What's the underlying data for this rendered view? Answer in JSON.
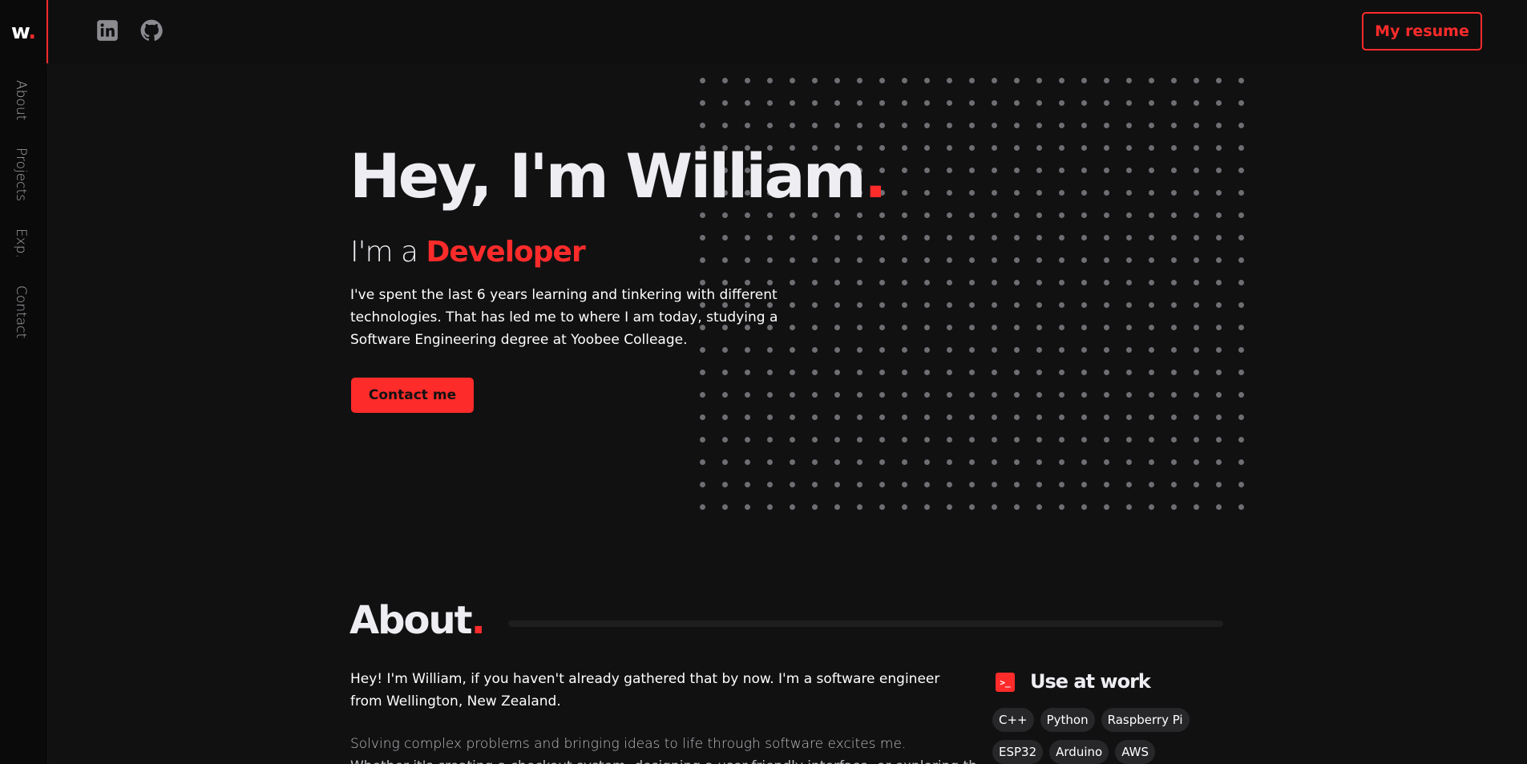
{
  "brand": {
    "logo_letter": "w",
    "logo_dot": "."
  },
  "sidenav": {
    "items": [
      "About",
      "Projects",
      "Exp.",
      "Contact"
    ]
  },
  "topbar": {
    "resume_label": "My resume"
  },
  "hero": {
    "title": "Hey, I'm William",
    "title_dot": ".",
    "subtitle_prefix": "I'm a ",
    "subtitle_role": "Developer",
    "description": "I've spent the last 6 years learning and tinkering with different technologies. That has led me to where I am today, studying a Software Engineering degree at Yoobee Colleage.",
    "contact_label": "Contact me"
  },
  "about": {
    "title": "About",
    "title_dot": ".",
    "p1": "Hey! I'm William, if you haven't already gathered that by now. I'm a software engineer from Wellington, New Zealand.",
    "p2": "Solving complex problems and bringing ideas to life through software excites me.",
    "p3": "Whether it's creating a checkout system, designing a user-friendly interface, or exploring the"
  },
  "work": {
    "title": "Use at work",
    "icon_label": ">_",
    "chips": [
      "C++",
      "Python",
      "Raspberry Pi",
      "ESP32",
      "Arduino",
      "AWS"
    ]
  },
  "colors": {
    "accent": "#fe2b2b",
    "background": "#111112",
    "text": "#ededf2"
  },
  "icons": {
    "linkedin": "linkedin-icon",
    "github": "github-icon",
    "terminal": "terminal-icon"
  }
}
